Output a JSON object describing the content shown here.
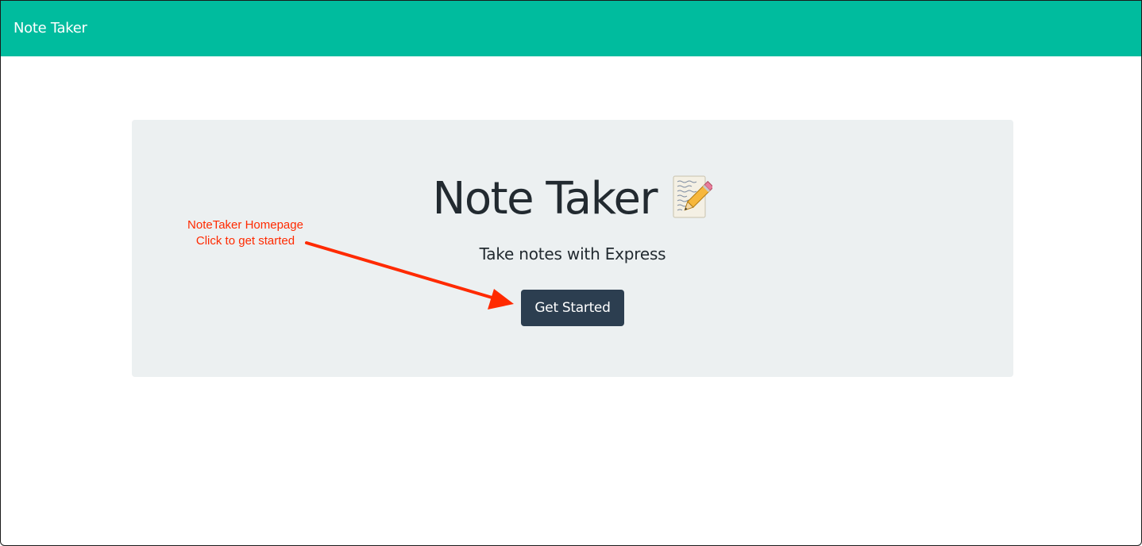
{
  "navbar": {
    "brand": "Note Taker",
    "background": "#00bc9e"
  },
  "hero": {
    "title": "Note Taker",
    "title_icon": "memo-icon",
    "subtitle": "Take notes with Express",
    "button_label": "Get Started",
    "background": "#ecf0f1",
    "button_color": "#2c3e50"
  },
  "annotation": {
    "line1": "NoteTaker Homepage",
    "line2": "Click to get started",
    "color": "#ff2a00",
    "icon": "arrow-icon"
  }
}
